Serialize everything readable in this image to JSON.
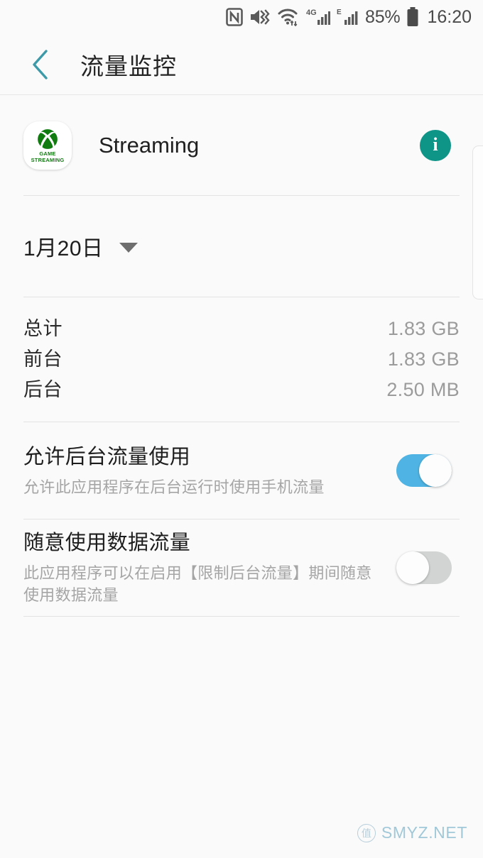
{
  "status_bar": {
    "icons": [
      "nfc-icon",
      "mute-vibrate-icon",
      "wifi-icon",
      "signal-4g-icon",
      "signal-e-icon"
    ],
    "network_4g_label": "4G",
    "network_e_label": "E",
    "battery_percent": "85%",
    "clock": "16:20"
  },
  "header": {
    "back_label": "‹",
    "title": "流量监控",
    "accent_color": "#3d9aa8"
  },
  "app": {
    "icon_label_line1": "GAME",
    "icon_label_line2": "STREAMING",
    "icon_brand_color": "#107c10",
    "name": "Streaming",
    "info_button_label": "i",
    "info_button_color": "#0f9488"
  },
  "date_selector": {
    "value": "1月20日",
    "caret": "chevron-down-icon"
  },
  "usage": {
    "rows": [
      {
        "label": "总计",
        "value": "1.83 GB"
      },
      {
        "label": "前台",
        "value": "1.83 GB"
      },
      {
        "label": "后台",
        "value": "2.50 MB"
      }
    ]
  },
  "settings": {
    "background_data": {
      "title": "允许后台流量使用",
      "subtitle": "允许此应用程序在后台运行时使用手机流量",
      "enabled": true,
      "on_color": "#4fb4e3"
    },
    "unrestricted_data": {
      "title": "随意使用数据流量",
      "subtitle": "此应用程序可以在启用【限制后台流量】期间随意使用数据流量",
      "enabled": false,
      "off_color": "#d2d4d4"
    }
  },
  "watermark": {
    "badge": "值",
    "text": "SMYZ.NET"
  }
}
